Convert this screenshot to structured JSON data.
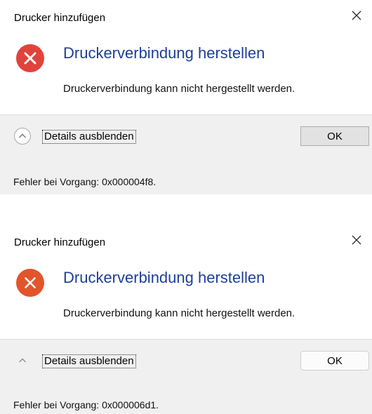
{
  "dialogs": [
    {
      "window_title": "Drucker hinzufügen",
      "heading": "Druckerverbindung herstellen",
      "message": "Druckerverbindung kann nicht hergestellt werden.",
      "details_label": "Details ausblenden",
      "ok_label": "OK",
      "error_code_text": "Fehler bei Vorgang: 0x000004f8.",
      "icon": "error-icon",
      "accent_color": "#1e3f9a",
      "error_color": "#e0433b"
    },
    {
      "window_title": "Drucker hinzufügen",
      "heading": "Druckerverbindung herstellen",
      "message": "Druckerverbindung kann nicht hergestellt werden.",
      "details_label": "Details ausblenden",
      "ok_label": "OK",
      "error_code_text": "Fehler bei Vorgang: 0x000006d1.",
      "icon": "error-icon",
      "accent_color": "#1e3f9a",
      "error_color": "#e2552b"
    }
  ]
}
